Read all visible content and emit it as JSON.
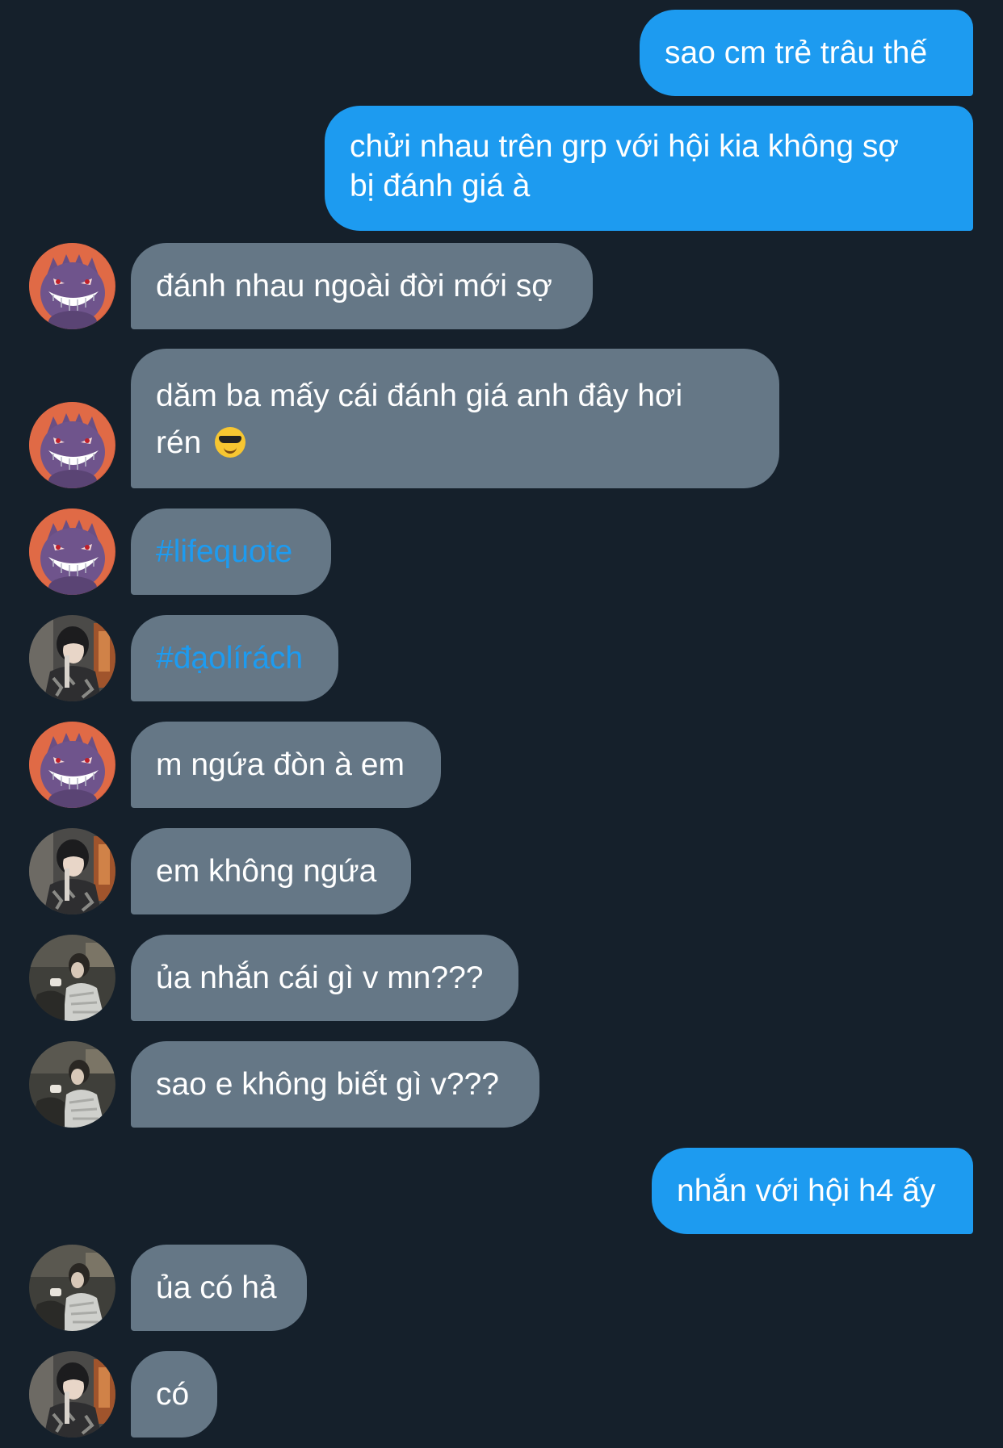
{
  "messages": [
    {
      "side": "sent",
      "text": "sao cm trẻ trâu thế"
    },
    {
      "side": "sent",
      "text": "chửi nhau trên grp với hội kia không sợ bị đánh giá à"
    },
    {
      "side": "received",
      "avatar": "gengar-avatar",
      "text": "đánh nhau ngoài đời mới sợ"
    },
    {
      "side": "received",
      "avatar": "gengar-avatar",
      "text": "dăm ba mấy cái đánh giá anh đây hơi rén",
      "emoji": "smiling-face-with-sunglasses"
    },
    {
      "side": "received",
      "avatar": "gengar-avatar",
      "text": "#lifequote"
    },
    {
      "side": "received",
      "avatar": "boy-photo-avatar",
      "text": "#đạolírách"
    },
    {
      "side": "received",
      "avatar": "gengar-avatar",
      "text": "m ngứa đòn à em"
    },
    {
      "side": "received",
      "avatar": "boy-photo-avatar",
      "text": "em không ngứa"
    },
    {
      "side": "received",
      "avatar": "person-photo-avatar",
      "text": "ủa nhắn cái gì v mn???"
    },
    {
      "side": "received",
      "avatar": "person-photo-avatar",
      "text": "sao e không biết gì v???"
    },
    {
      "side": "sent",
      "text": "nhắn với hội h4 ấy"
    },
    {
      "side": "received",
      "avatar": "person-photo-avatar",
      "text": "ủa có hả"
    },
    {
      "side": "received",
      "avatar": "boy-photo-avatar",
      "text": "có"
    }
  ],
  "colors": {
    "background": "#15202b",
    "sent_bubble": "#1d9bf0",
    "received_bubble": "#657786",
    "hashtag": "#1d9bf0",
    "text": "#ffffff"
  }
}
